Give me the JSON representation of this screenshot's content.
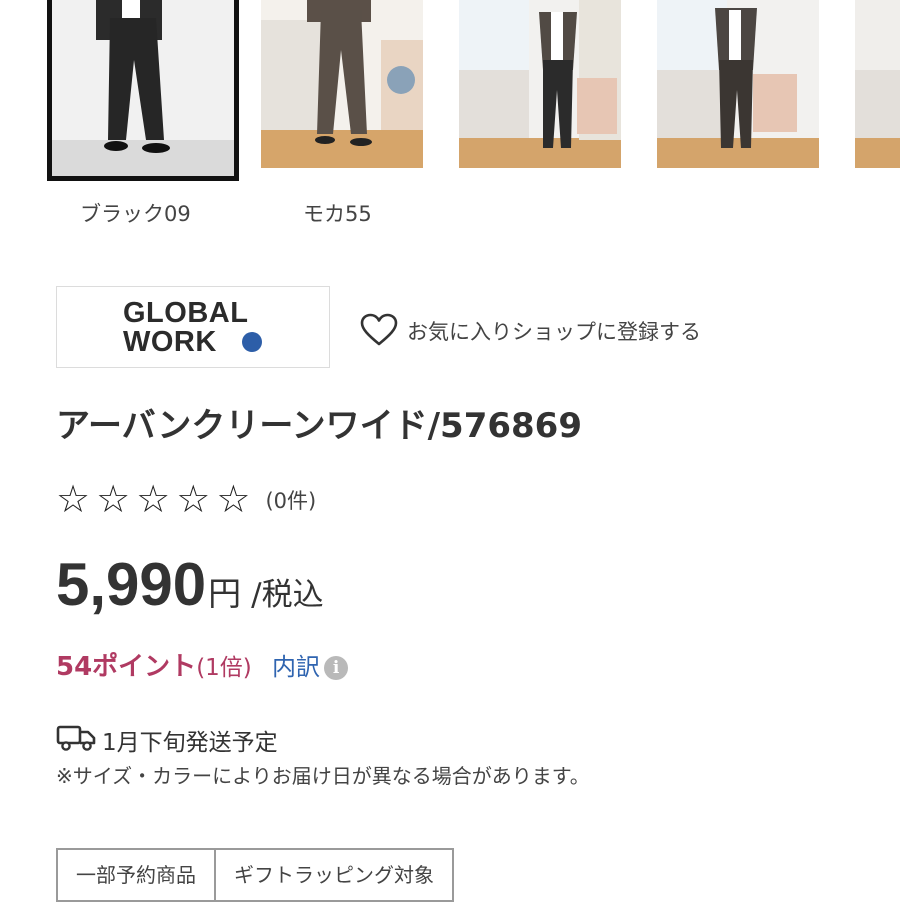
{
  "color_options": [
    {
      "label": "ブラック09",
      "selected": true
    },
    {
      "label": "モカ55",
      "selected": false
    }
  ],
  "shop": {
    "logo_line1": "GLOBAL",
    "logo_line2": "WORK",
    "favorite_label": "お気に入りショップに登録する"
  },
  "product": {
    "title": "アーバンクリーンワイド/576869",
    "rating": {
      "stars": [
        "☆",
        "☆",
        "☆",
        "☆",
        "☆"
      ],
      "count_text": "(0件)"
    },
    "price": {
      "value": "5,990",
      "unit": "円",
      "tax_label": "/税込"
    },
    "points": {
      "value": "54ポイント",
      "rate": "(1倍)",
      "breakdown_label": "内訳",
      "info_icon": "i"
    },
    "shipping": {
      "date_text": "1月下旬発送予定",
      "note": "※サイズ・カラーによりお届け日が異なる場合があります。"
    },
    "tags": [
      "一部予約商品",
      "ギフトラッピング対象"
    ]
  },
  "colors": {
    "points_accent": "#b03a62",
    "link": "#2f64b0",
    "logo_dot": "#2d5ea8",
    "selected_border": "#111111"
  }
}
